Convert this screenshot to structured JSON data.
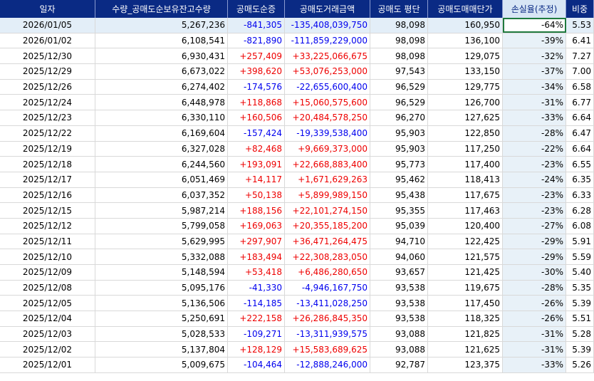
{
  "headers": [
    "일자",
    "수량_공매도순보유잔고수량",
    "공매도순증",
    "공매도거래금액",
    "공매도 평단",
    "공매도매매단가",
    "손실율(추정)",
    "비중"
  ],
  "rows": [
    [
      "2026/01/05",
      "5,267,236",
      "-841,305",
      "-135,408,039,750",
      "98,098",
      "160,950",
      "-64%",
      "5.53"
    ],
    [
      "2026/01/02",
      "6,108,541",
      "-821,890",
      "-111,859,229,000",
      "98,098",
      "136,100",
      "-39%",
      "6.41"
    ],
    [
      "2025/12/30",
      "6,930,431",
      "+257,409",
      "+33,225,066,675",
      "98,098",
      "129,075",
      "-32%",
      "7.27"
    ],
    [
      "2025/12/29",
      "6,673,022",
      "+398,620",
      "+53,076,253,000",
      "97,543",
      "133,150",
      "-37%",
      "7.00"
    ],
    [
      "2025/12/26",
      "6,274,402",
      "-174,576",
      "-22,655,600,400",
      "96,529",
      "129,775",
      "-34%",
      "6.58"
    ],
    [
      "2025/12/24",
      "6,448,978",
      "+118,868",
      "+15,060,575,600",
      "96,529",
      "126,700",
      "-31%",
      "6.77"
    ],
    [
      "2025/12/23",
      "6,330,110",
      "+160,506",
      "+20,484,578,250",
      "96,270",
      "127,625",
      "-33%",
      "6.64"
    ],
    [
      "2025/12/22",
      "6,169,604",
      "-157,424",
      "-19,339,538,400",
      "95,903",
      "122,850",
      "-28%",
      "6.47"
    ],
    [
      "2025/12/19",
      "6,327,028",
      "+82,468",
      "+9,669,373,000",
      "95,903",
      "117,250",
      "-22%",
      "6.64"
    ],
    [
      "2025/12/18",
      "6,244,560",
      "+193,091",
      "+22,668,883,400",
      "95,773",
      "117,400",
      "-23%",
      "6.55"
    ],
    [
      "2025/12/17",
      "6,051,469",
      "+14,117",
      "+1,671,629,263",
      "95,462",
      "118,413",
      "-24%",
      "6.35"
    ],
    [
      "2025/12/16",
      "6,037,352",
      "+50,138",
      "+5,899,989,150",
      "95,438",
      "117,675",
      "-23%",
      "6.33"
    ],
    [
      "2025/12/15",
      "5,987,214",
      "+188,156",
      "+22,101,274,150",
      "95,355",
      "117,463",
      "-23%",
      "6.28"
    ],
    [
      "2025/12/12",
      "5,799,058",
      "+169,063",
      "+20,355,185,200",
      "95,039",
      "120,400",
      "-27%",
      "6.08"
    ],
    [
      "2025/12/11",
      "5,629,995",
      "+297,907",
      "+36,471,264,475",
      "94,710",
      "122,425",
      "-29%",
      "5.91"
    ],
    [
      "2025/12/10",
      "5,332,088",
      "+183,494",
      "+22,308,283,050",
      "94,060",
      "121,575",
      "-29%",
      "5.59"
    ],
    [
      "2025/12/09",
      "5,148,594",
      "+53,418",
      "+6,486,280,650",
      "93,657",
      "121,425",
      "-30%",
      "5.40"
    ],
    [
      "2025/12/08",
      "5,095,176",
      "-41,330",
      "-4,946,167,750",
      "93,538",
      "119,675",
      "-28%",
      "5.35"
    ],
    [
      "2025/12/05",
      "5,136,506",
      "-114,185",
      "-13,411,028,250",
      "93,538",
      "117,450",
      "-26%",
      "5.39"
    ],
    [
      "2025/12/04",
      "5,250,691",
      "+222,158",
      "+26,286,845,350",
      "93,538",
      "118,325",
      "-26%",
      "5.51"
    ],
    [
      "2025/12/03",
      "5,028,533",
      "-109,271",
      "-13,311,939,575",
      "93,088",
      "121,825",
      "-31%",
      "5.28"
    ],
    [
      "2025/12/02",
      "5,137,804",
      "+128,129",
      "+15,583,689,625",
      "93,088",
      "121,625",
      "-31%",
      "5.39"
    ],
    [
      "2025/12/01",
      "5,009,675",
      "-104,464",
      "-12,888,246,000",
      "92,787",
      "123,375",
      "-33%",
      "5.26"
    ]
  ]
}
